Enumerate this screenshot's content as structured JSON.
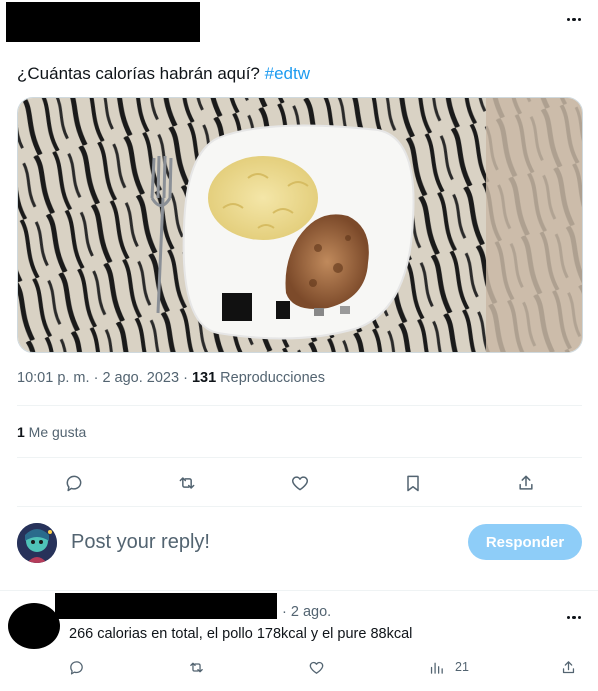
{
  "tweet": {
    "text": "¿Cuántas calorías habrán aquí? ",
    "hashtag": "#edtw",
    "time": "10:01 p. m.",
    "sep1": " · ",
    "date": "2 ago. 2023",
    "sep2": " · ",
    "views_count": "131",
    "views_label": " Reproducciones",
    "likes_count": "1",
    "likes_label": " Me gusta"
  },
  "actions": {
    "reply_icon": "reply-icon",
    "retweet_icon": "retweet-icon",
    "like_icon": "heart-icon",
    "bookmark_icon": "bookmark-icon",
    "share_icon": "share-icon"
  },
  "composer": {
    "placeholder": "Post your reply!",
    "button_label": "Responder"
  },
  "reply": {
    "date": "· 2 ago.",
    "text": "266 calorias en total, el pollo 178kcal y el pure 88kcal",
    "views": "21"
  },
  "colors": {
    "accent": "#1d9bf0",
    "button_disabled": "#8ecdf8",
    "muted": "#536471"
  }
}
